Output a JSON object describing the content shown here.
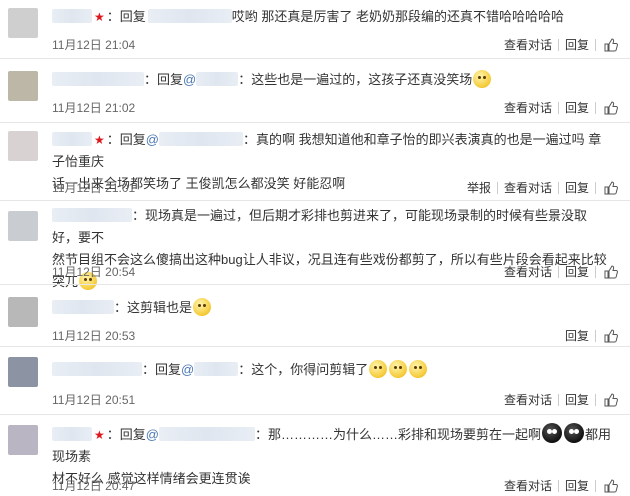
{
  "labels": {
    "reply": "回复",
    "at": "@",
    "view_dialog": "查看对话",
    "reply_btn": "回复",
    "report": "举报",
    "delete": "取赞"
  },
  "comments": [
    {
      "content": "哎哟 那还真是厉害了 老奶奶那段编的还真不错哈哈哈哈哈",
      "time": "11月12日 21:04"
    },
    {
      "content": "这些也是一遍过的，这孩子还真没笑场",
      "time": "11月12日 21:02"
    },
    {
      "content_line1": "真的啊 我想知道他和章子怡的即兴表演真的也是一遍过吗 章子怡重庆",
      "content_line2": "话一出来全场都笑场了 王俊凯怎么都没笑 好能忍啊",
      "time": "11月12日 21:01"
    },
    {
      "content_line1": "现场真是一遍过，但后期才彩排也剪进来了，可能现场录制的时候有些景没取好，要不",
      "content_line2": "然节目组不会这么傻搞出这种bug让人非议，况且连有些戏份都剪了，所以有些片段会看起来比较突兀",
      "time": "11月12日 20:54"
    },
    {
      "content": "这剪辑也是",
      "time": "11月12日 20:53"
    },
    {
      "content": "这个，你得问剪辑了",
      "time": "11月12日 20:51"
    },
    {
      "content_line1a": "那…………为什么……彩排和现场要剪在一起啊",
      "content_line1b": "都用现场素",
      "content_line2": "材不好么 感觉这样情绪会更连贯诶",
      "time": "11月12日 20:47"
    }
  ]
}
